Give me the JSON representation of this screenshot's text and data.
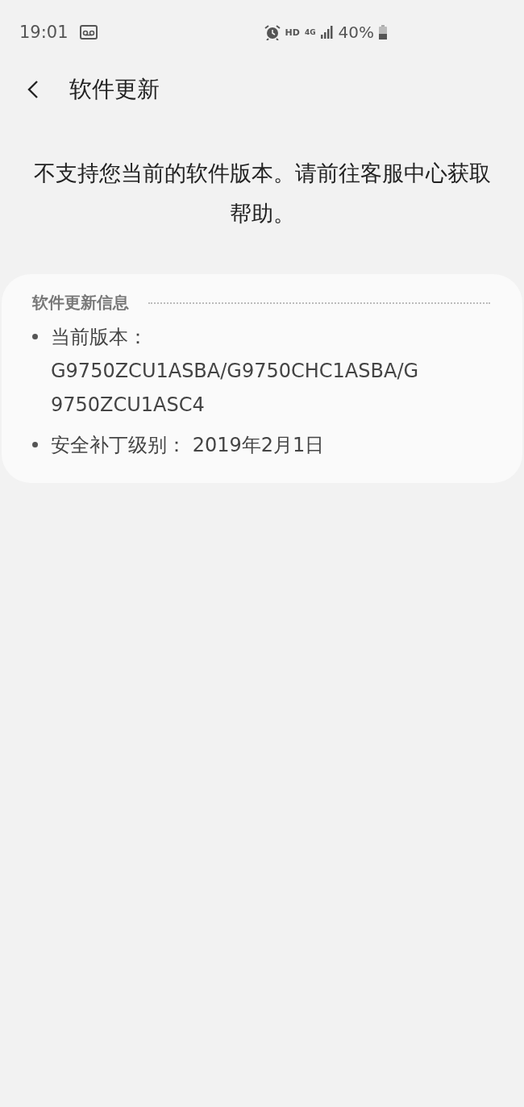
{
  "status_bar": {
    "time": "19:01",
    "hd": "HD",
    "network": "4G",
    "battery": "40%"
  },
  "header": {
    "title": "软件更新"
  },
  "message": "不支持您当前的软件版本。请前往客服中心获取帮助。",
  "info_card": {
    "title": "软件更新信息",
    "items": [
      {
        "text": "当前版本：G9750ZCU1ASBA/G9750CHC1ASBA/G9750ZCU1ASC4"
      },
      {
        "text": "安全补丁级别： 2019年2月1日"
      }
    ]
  }
}
